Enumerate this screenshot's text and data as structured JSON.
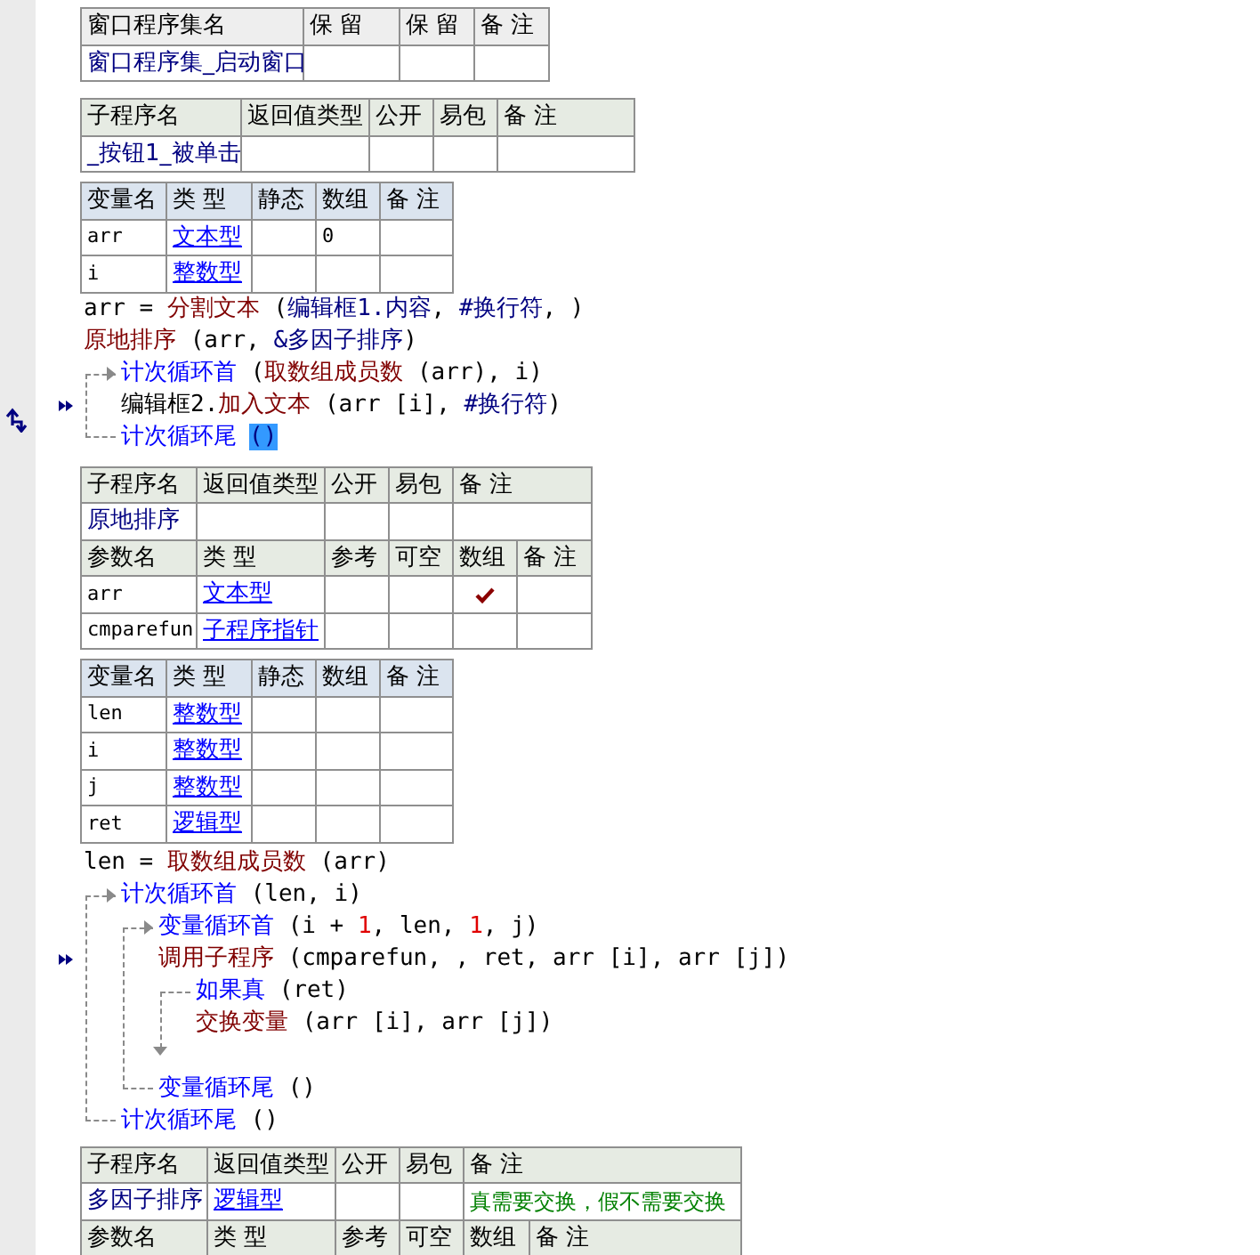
{
  "blocks": [
    {
      "kind": "assembly_table",
      "rows": [
        {
          "header": true,
          "cells": [
            {
              "text": "窗口程序集名"
            },
            {
              "text": "保 留"
            },
            {
              "text": "保 留"
            },
            {
              "text": "备 注"
            }
          ]
        },
        {
          "header": false,
          "cells": [
            {
              "text": "窗口程序集_启动窗口",
              "kind": "name"
            },
            {},
            {},
            {}
          ]
        }
      ]
    },
    {
      "kind": "subroutine_table",
      "rows": [
        {
          "header": true,
          "cells": [
            {
              "text": "子程序名"
            },
            {
              "text": "返回值类型"
            },
            {
              "text": "公开"
            },
            {
              "text": "易包"
            },
            {
              "text": "备 注"
            }
          ]
        },
        {
          "header": false,
          "cells": [
            {
              "text": "_按钮1_被单击",
              "kind": "name"
            },
            {},
            {},
            {},
            {}
          ]
        }
      ]
    },
    {
      "kind": "variable_table",
      "rows": [
        {
          "header": true,
          "cells": [
            {
              "text": "变量名"
            },
            {
              "text": "类 型"
            },
            {
              "text": "静态"
            },
            {
              "text": "数组"
            },
            {
              "text": "备 注"
            }
          ]
        },
        {
          "header": false,
          "cells": [
            {
              "text": "arr",
              "kind": "var"
            },
            {
              "text": "文本型",
              "kind": "type"
            },
            {},
            {
              "text": "0",
              "kind": "var"
            },
            {}
          ]
        },
        {
          "header": false,
          "cells": [
            {
              "text": "i",
              "kind": "var"
            },
            {
              "text": "整数型",
              "kind": "type"
            },
            {},
            {},
            {}
          ]
        }
      ]
    },
    {
      "kind": "code",
      "lines": [
        {
          "tokens": [
            {
              "t": "arr = ",
              "kind": "text"
            },
            {
              "t": "分割文本",
              "kind": "func"
            },
            {
              "t": " (",
              "kind": "text"
            },
            {
              "t": "编辑框1.内容",
              "kind": "const"
            },
            {
              "t": ", ",
              "kind": "text"
            },
            {
              "t": "#换行符",
              "kind": "const"
            },
            {
              "t": ", )",
              "kind": "text"
            }
          ]
        },
        {
          "tokens": [
            {
              "t": "原地排序",
              "kind": "func"
            },
            {
              "t": " (arr, ",
              "kind": "text"
            },
            {
              "t": "&多因子排序",
              "kind": "const"
            },
            {
              "t": ")",
              "kind": "text"
            }
          ]
        },
        {
          "kind": "loop",
          "tokens": [
            {
              "t": "计次循环首",
              "kind": "keyword"
            },
            {
              "t": " (",
              "kind": "text"
            },
            {
              "t": "取数组成员数",
              "kind": "func"
            },
            {
              "t": " (arr), i)",
              "kind": "text"
            }
          ],
          "children": [
            {
              "marker": {
                "kind": "step"
              },
              "tokens": [
                {
                  "t": "编辑框2.",
                  "kind": "text"
                },
                {
                  "t": "加入文本",
                  "kind": "func"
                },
                {
                  "t": " (arr [i], ",
                  "kind": "text"
                },
                {
                  "t": "#换行符",
                  "kind": "const"
                },
                {
                  "t": ")",
                  "kind": "text"
                }
              ]
            }
          ],
          "end": {
            "marker": {
              "kind": "swap"
            },
            "tokens": [
              {
                "t": "计次循环尾",
                "kind": "keyword"
              },
              {
                "t": "()",
                "kind": "cursor"
              }
            ]
          }
        }
      ]
    },
    {
      "kind": "subroutine_table",
      "rows": [
        {
          "header": true,
          "cells": [
            {
              "text": "子程序名"
            },
            {
              "text": "返回值类型"
            },
            {
              "text": "公开"
            },
            {
              "text": "易包"
            },
            {
              "text": "备 注"
            }
          ]
        },
        {
          "header": false,
          "cells": [
            {
              "text": "原地排序",
              "kind": "name"
            },
            {},
            {},
            {},
            {}
          ]
        },
        {
          "header": true,
          "cells": [
            {
              "text": "参数名"
            },
            {
              "text": "类 型"
            },
            {
              "text": "参考"
            },
            {
              "text": "可空"
            },
            {
              "text": "数组"
            },
            {
              "text": "备 注"
            }
          ]
        },
        {
          "header": false,
          "cells": [
            {
              "text": "arr",
              "kind": "var"
            },
            {
              "text": "文本型",
              "kind": "type"
            },
            {},
            {},
            {
              "kind": "check",
              "checked": true
            },
            {}
          ]
        },
        {
          "header": false,
          "cells": [
            {
              "text": "cmparefun",
              "kind": "var"
            },
            {
              "text": "子程序指针",
              "kind": "type"
            },
            {},
            {},
            {},
            {}
          ]
        }
      ]
    },
    {
      "kind": "variable_table",
      "rows": [
        {
          "header": true,
          "cells": [
            {
              "text": "变量名"
            },
            {
              "text": "类 型"
            },
            {
              "text": "静态"
            },
            {
              "text": "数组"
            },
            {
              "text": "备 注"
            }
          ]
        },
        {
          "header": false,
          "cells": [
            {
              "text": "len",
              "kind": "var"
            },
            {
              "text": "整数型",
              "kind": "type"
            },
            {},
            {},
            {}
          ]
        },
        {
          "header": false,
          "cells": [
            {
              "text": "i",
              "kind": "var"
            },
            {
              "text": "整数型",
              "kind": "type"
            },
            {},
            {},
            {}
          ]
        },
        {
          "header": false,
          "cells": [
            {
              "text": "j",
              "kind": "var"
            },
            {
              "text": "整数型",
              "kind": "type"
            },
            {},
            {},
            {}
          ]
        },
        {
          "header": false,
          "cells": [
            {
              "text": "ret",
              "kind": "var"
            },
            {
              "text": "逻辑型",
              "kind": "type"
            },
            {},
            {},
            {}
          ]
        }
      ]
    },
    {
      "kind": "code",
      "lines": [
        {
          "tokens": [
            {
              "t": "len = ",
              "kind": "text"
            },
            {
              "t": "取数组成员数",
              "kind": "func"
            },
            {
              "t": " (arr)",
              "kind": "text"
            }
          ]
        },
        {
          "kind": "loop",
          "tokens": [
            {
              "t": "计次循环首",
              "kind": "keyword"
            },
            {
              "t": " (len, i)",
              "kind": "text"
            }
          ],
          "children": [
            {
              "kind": "loop",
              "tokens": [
                {
                  "t": "变量循环首",
                  "kind": "keyword"
                },
                {
                  "t": " (i + ",
                  "kind": "text"
                },
                {
                  "t": "1",
                  "kind": "number"
                },
                {
                  "t": ", len, ",
                  "kind": "text"
                },
                {
                  "t": "1",
                  "kind": "number"
                },
                {
                  "t": ", j)",
                  "kind": "text"
                }
              ],
              "children": [
                {
                  "marker": {
                    "kind": "step"
                  },
                  "tokens": [
                    {
                      "t": "调用子程序",
                      "kind": "func"
                    },
                    {
                      "t": " (cmparefun, , ret, arr [i], arr [j])",
                      "kind": "text"
                    }
                  ]
                },
                {
                  "kind": "if",
                  "tokens": [
                    {
                      "t": "如果真",
                      "kind": "keyword"
                    },
                    {
                      "t": " (ret)",
                      "kind": "text"
                    }
                  ],
                  "children": [
                    {
                      "tokens": [
                        {
                          "t": "交换变量",
                          "kind": "func"
                        },
                        {
                          "t": " (arr [i], arr [j])",
                          "kind": "text"
                        }
                      ]
                    }
                  ]
                }
              ],
              "end": {
                "tokens": [
                  {
                    "t": "变量循环尾",
                    "kind": "keyword"
                  },
                  {
                    "t": " ()",
                    "kind": "text"
                  }
                ]
              }
            }
          ],
          "end": {
            "tokens": [
              {
                "t": "计次循环尾",
                "kind": "keyword"
              },
              {
                "t": " ()",
                "kind": "text"
              }
            ]
          }
        }
      ]
    },
    {
      "kind": "subroutine_table",
      "rows": [
        {
          "header": true,
          "cells": [
            {
              "text": "子程序名"
            },
            {
              "text": "返回值类型"
            },
            {
              "text": "公开"
            },
            {
              "text": "易包"
            },
            {
              "text": "备 注"
            }
          ]
        },
        {
          "header": false,
          "cells": [
            {
              "text": "多因子排序",
              "kind": "name"
            },
            {
              "text": "逻辑型",
              "kind": "type"
            },
            {},
            {},
            {
              "text": "真需要交换，假不需要交换",
              "kind": "comment"
            }
          ]
        },
        {
          "header": true,
          "cells": [
            {
              "text": "参数名"
            },
            {
              "text": "类 型"
            },
            {
              "text": "参考"
            },
            {
              "text": "可空"
            },
            {
              "text": "数组"
            },
            {
              "text": "备 注"
            }
          ]
        }
      ]
    }
  ]
}
